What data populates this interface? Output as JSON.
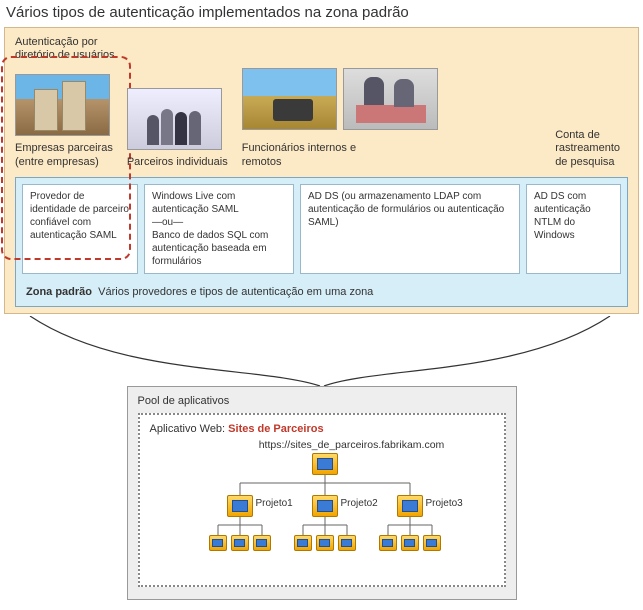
{
  "title": "Vários tipos de autenticação implementados na zona padrão",
  "auth_header": "Autenticação por\ndiretório de usuários",
  "partners": [
    {
      "label": "Empresas parceiras\n(entre empresas)"
    },
    {
      "label": "Parceiros individuais"
    },
    {
      "label": "Funcionários internos e remotos"
    },
    {
      "label": "Conta de\nrastreamento\nde pesquisa"
    }
  ],
  "auth_boxes": [
    "Provedor de identidade de parceiro confiável com autenticação SAML",
    "Windows Live com autenticação SAML\n—ou—\nBanco de dados SQL com autenticação baseada em formulários",
    "AD DS (ou armazenamento LDAP com autenticação de formulários ou autenticação SAML)",
    "AD DS com autenticação NTLM do Windows"
  ],
  "zone_footer_bold": "Zona padrão",
  "zone_footer_rest": "Vários provedores e tipos de autenticação em uma zona",
  "pool_title": "Pool de aplicativos",
  "webapp_label": "Aplicativo Web:",
  "webapp_name": "Sites de Parceiros",
  "site_url": "https://sites_de_parceiros.fabrikam.com",
  "projects": [
    "Projeto1",
    "Projeto2",
    "Projeto3"
  ]
}
